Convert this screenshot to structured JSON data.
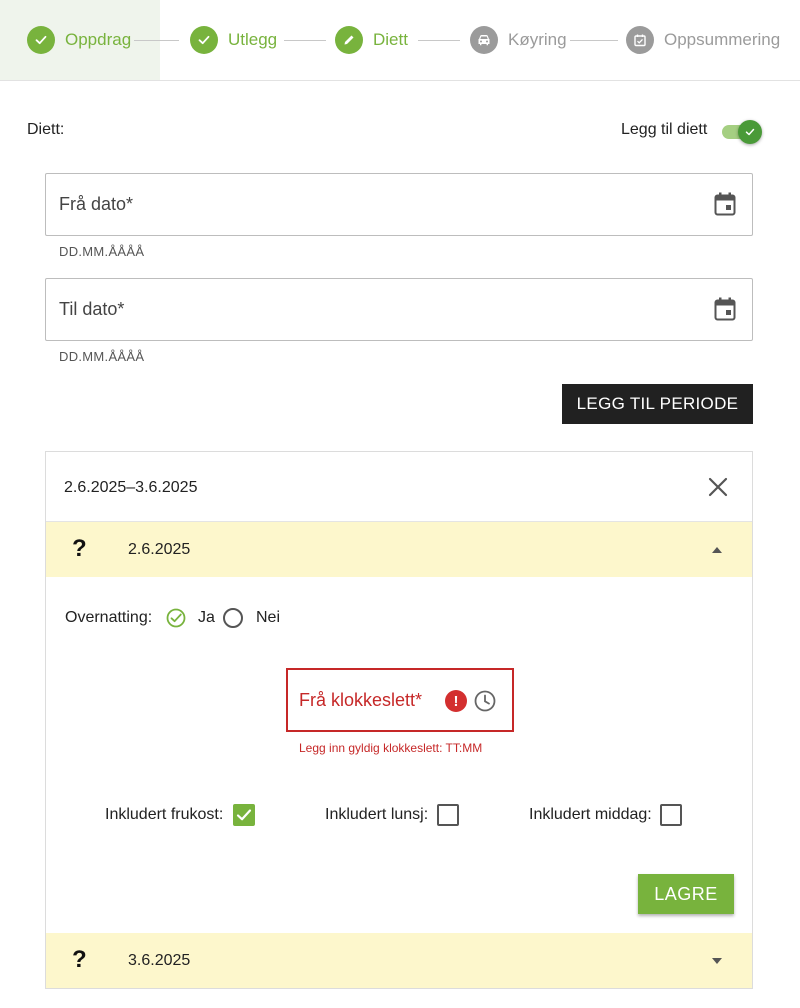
{
  "stepper": {
    "steps": [
      {
        "label": "Oppdrag",
        "icon": "check-icon",
        "state": "done"
      },
      {
        "label": "Utlegg",
        "icon": "check-icon",
        "state": "done"
      },
      {
        "label": "Diett",
        "icon": "pencil-icon",
        "state": "current"
      },
      {
        "label": "Køyring",
        "icon": "car-icon",
        "state": "todo"
      },
      {
        "label": "Oppsummering",
        "icon": "calendar-check-icon",
        "state": "todo"
      }
    ]
  },
  "diett": {
    "label": "Diett:",
    "toggle_label": "Legg til diett",
    "toggle_on": true
  },
  "from_date": {
    "label": "Frå dato*",
    "hint": "DD.MM.ÅÅÅÅ",
    "value": ""
  },
  "to_date": {
    "label": "Til dato*",
    "hint": "DD.MM.ÅÅÅÅ",
    "value": ""
  },
  "add_period_label": "LEGG TIL PERIODE",
  "period": {
    "title": "2.6.2025–3.6.2025",
    "days": [
      {
        "status_icon": "?",
        "date": "2.6.2025",
        "expanded": true,
        "overnight_label": "Overnatting:",
        "overnight_yes": "Ja",
        "overnight_no": "Nei",
        "overnight_selected": "Ja",
        "time_label": "Frå klokkeslett*",
        "time_error": "Legg inn gyldig klokkeslett: TT:MM",
        "meals": [
          {
            "label": "Inkludert frukost:",
            "checked": true
          },
          {
            "label": "Inkludert lunsj:",
            "checked": false
          },
          {
            "label": "Inkludert middag:",
            "checked": false
          }
        ],
        "save_label": "LAGRE"
      },
      {
        "status_icon": "?",
        "date": "3.6.2025",
        "expanded": false
      }
    ]
  },
  "colors": {
    "accent_green": "#78b33d",
    "error_red": "#c62828",
    "day_row_bg": "#fdf7cc",
    "dark_button": "#212121"
  }
}
